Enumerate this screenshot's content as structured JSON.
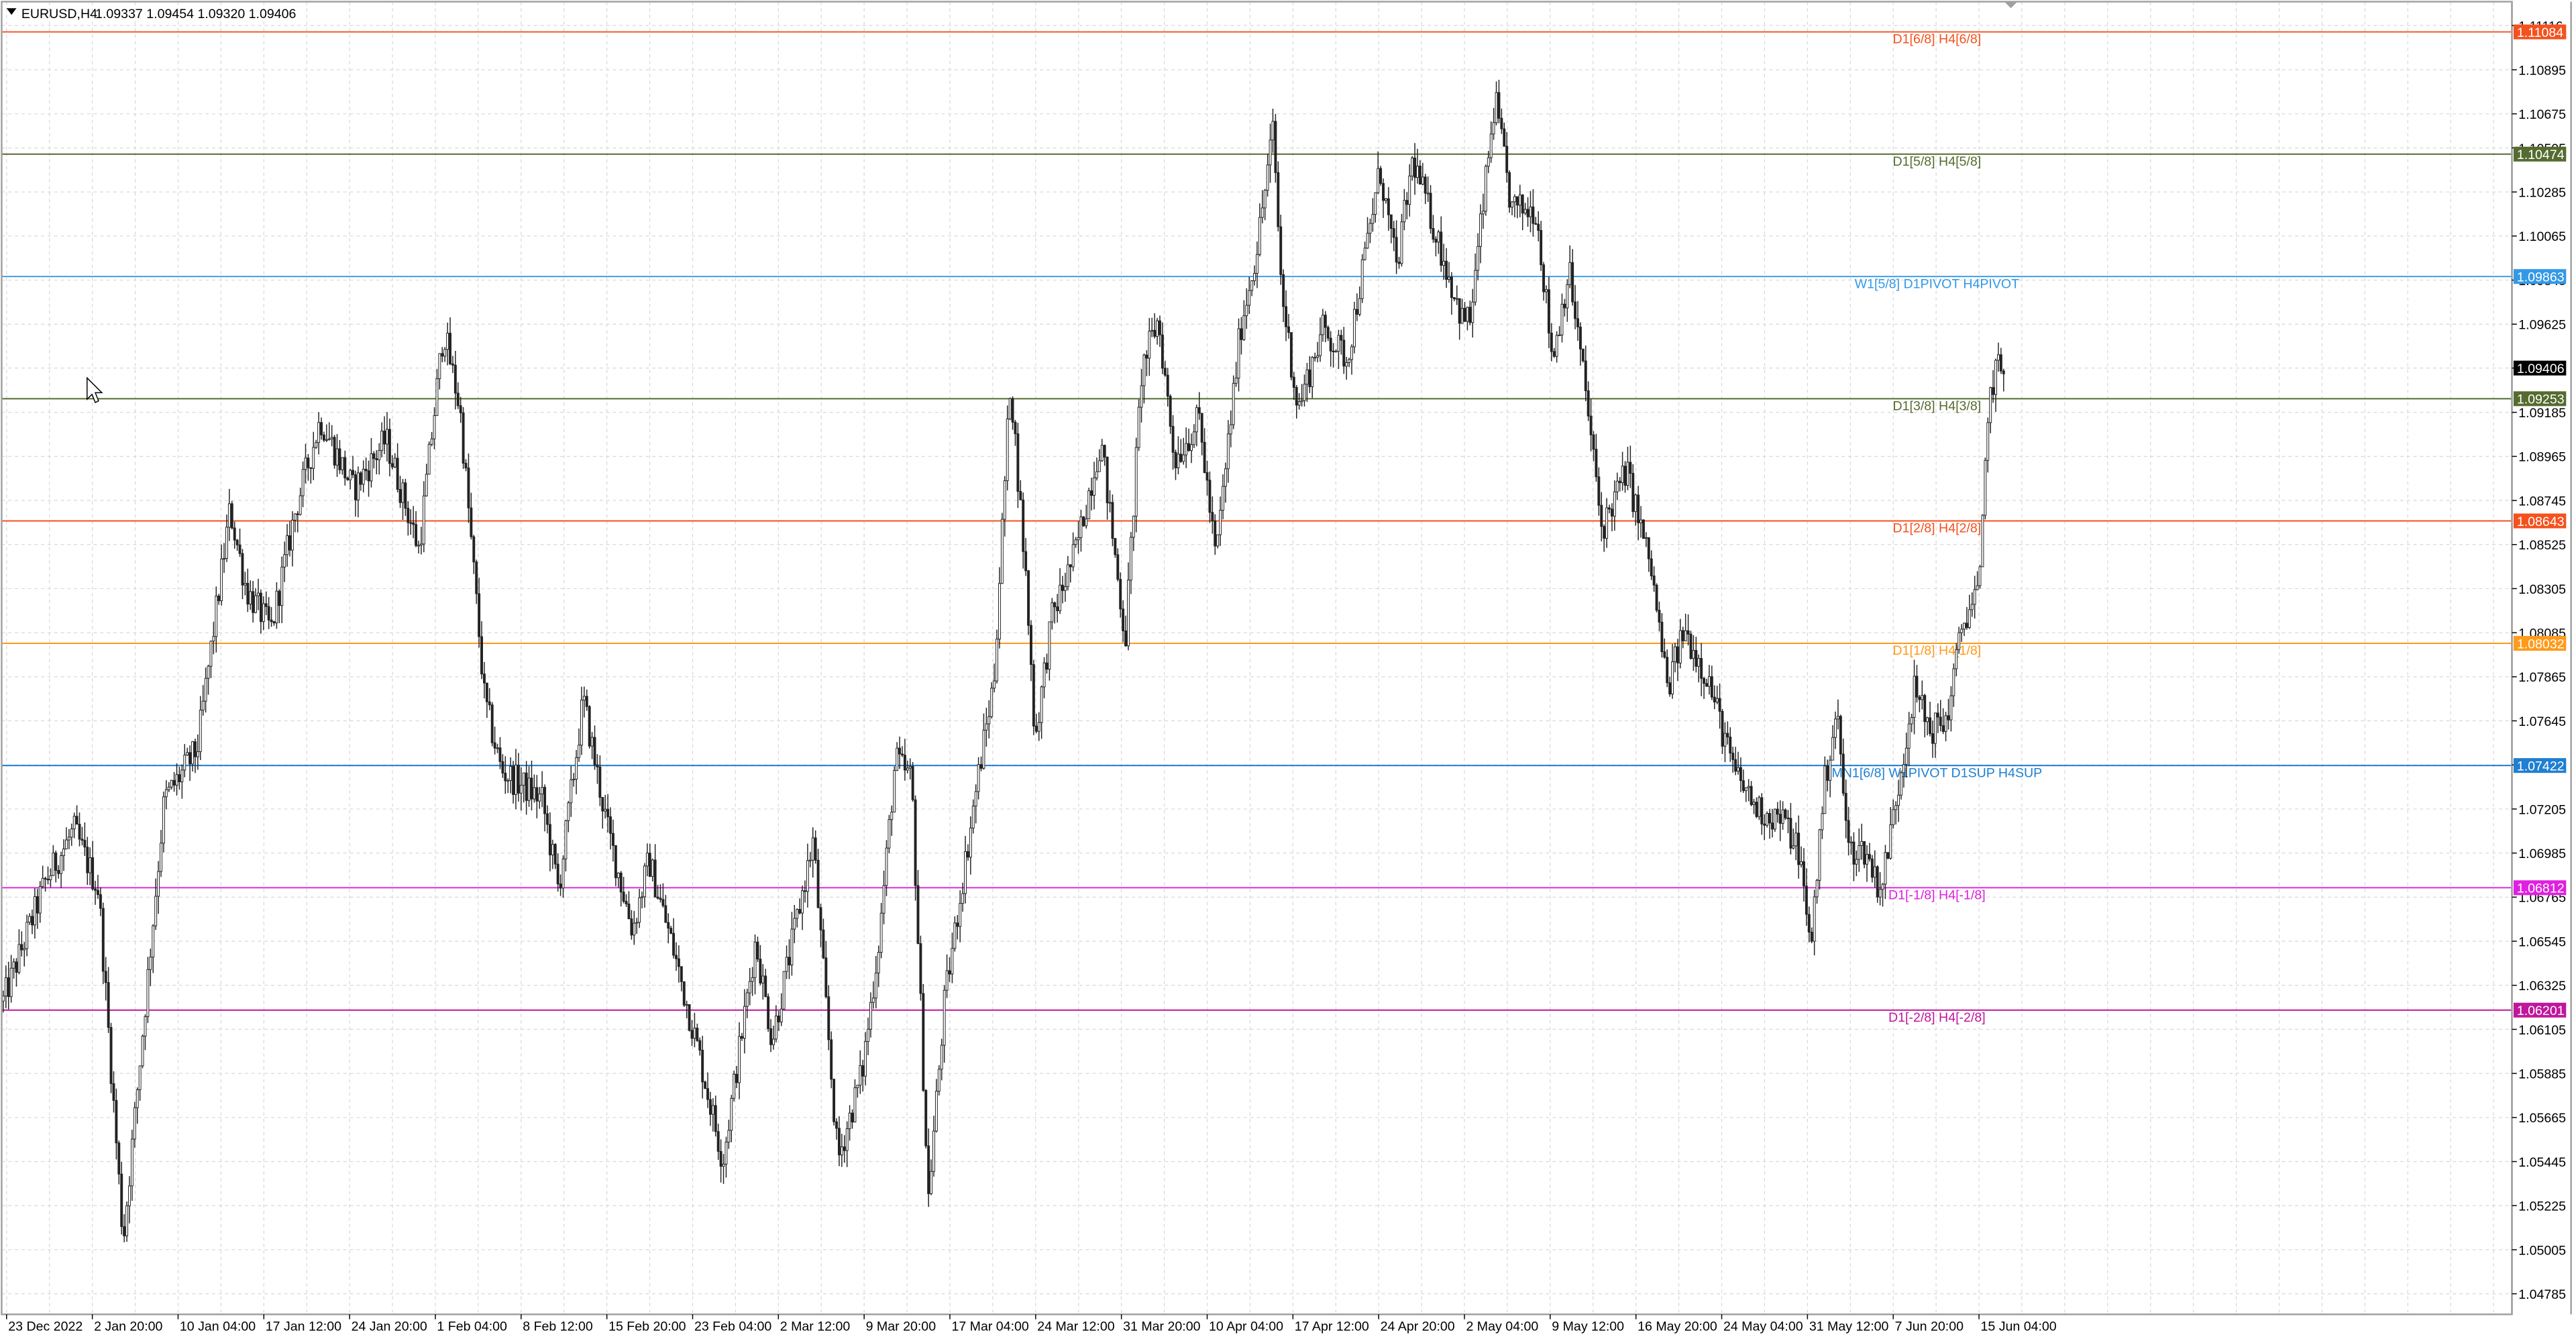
{
  "header": {
    "symbol_timeframe": "EURUSD,H4",
    "ohlc": "1.09337 1.09454 1.09320 1.09406",
    "menu_icon": "triangle-down-icon"
  },
  "chart_data": {
    "type": "candlestick",
    "symbol": "EURUSD",
    "timeframe": "H4",
    "last_bar": {
      "open": 1.09337,
      "high": 1.09454,
      "low": 1.0932,
      "close": 1.09406
    },
    "current_price": 1.09406,
    "ylim": [
      1.04675,
      1.11216
    ],
    "grid": true,
    "price_ticks": [
      "1.11116",
      "1.10895",
      "1.10675",
      "1.10505",
      "1.10285",
      "1.10065",
      "1.09845",
      "1.09625",
      "1.09406",
      "1.09185",
      "1.08965",
      "1.08745",
      "1.08525",
      "1.08305",
      "1.08085",
      "1.07865",
      "1.07645",
      "1.07425",
      "1.07205",
      "1.06985",
      "1.06765",
      "1.06545",
      "1.06325",
      "1.06105",
      "1.05885",
      "1.05665",
      "1.05445",
      "1.05225",
      "1.05005",
      "1.04785"
    ],
    "time_ticks": [
      "23 Dec 2022",
      "2 Jan 20:00",
      "10 Jan 04:00",
      "17 Jan 12:00",
      "24 Jan 20:00",
      "1 Feb 04:00",
      "8 Feb 12:00",
      "15 Feb 20:00",
      "23 Feb 04:00",
      "2 Mar 12:00",
      "9 Mar 20:00",
      "17 Mar 04:00",
      "24 Mar 12:00",
      "31 Mar 20:00",
      "10 Apr 04:00",
      "17 Apr 12:00",
      "24 Apr 20:00",
      "2 May 04:00",
      "9 May 12:00",
      "16 May 20:00",
      "24 May 04:00",
      "31 May 12:00",
      "7 Jun 20:00",
      "15 Jun 04:00"
    ],
    "levels": [
      {
        "price": 1.11084,
        "label": "D1[6/8] H4[6/8]",
        "tag": "1.11084",
        "color": "#f4511e"
      },
      {
        "price": 1.10474,
        "label": "D1[5/8] H4[5/8]",
        "tag": "1.10474",
        "color": "#556b2f"
      },
      {
        "price": 1.09863,
        "label": "W1[5/8] D1PIVOT H4PIVOT",
        "tag": "1.09863",
        "color": "#3399e6"
      },
      {
        "price": 1.09253,
        "label": "D1[3/8] H4[3/8]",
        "tag": "1.09253",
        "color": "#556b2f"
      },
      {
        "price": 1.08643,
        "label": "D1[2/8] H4[2/8]",
        "tag": "1.08643",
        "color": "#f4511e"
      },
      {
        "price": 1.08032,
        "label": "D1[1/8] H4[1/8]",
        "tag": "1.08032",
        "color": "#ff9a1a"
      },
      {
        "price": 1.07422,
        "label": "MN1[6/8] W1PIVOT D1SUP H4SUP",
        "tag": "1.07422",
        "color": "#1f7fd1"
      },
      {
        "price": 1.06812,
        "label": "D1[-1/8] H4[-1/8]",
        "tag": "1.06812",
        "color": "#e020e0"
      },
      {
        "price": 1.06201,
        "label": "D1[-2/8] H4[-2/8]",
        "tag": "1.06201",
        "color": "#c0169c"
      }
    ],
    "waypoints": [
      [
        0,
        1.062
      ],
      [
        28,
        1.0685
      ],
      [
        45,
        1.071
      ],
      [
        60,
        1.068
      ],
      [
        75,
        1.0505
      ],
      [
        100,
        1.0725
      ],
      [
        120,
        1.075
      ],
      [
        140,
        1.087
      ],
      [
        150,
        1.083
      ],
      [
        165,
        1.081
      ],
      [
        180,
        1.087
      ],
      [
        195,
        1.0915
      ],
      [
        215,
        1.088
      ],
      [
        235,
        1.0905
      ],
      [
        255,
        1.085
      ],
      [
        270,
        1.096
      ],
      [
        280,
        1.092
      ],
      [
        295,
        1.0775
      ],
      [
        305,
        1.074
      ],
      [
        330,
        1.0725
      ],
      [
        340,
        1.068
      ],
      [
        355,
        1.0775
      ],
      [
        370,
        1.071
      ],
      [
        385,
        1.066
      ],
      [
        395,
        1.0695
      ],
      [
        410,
        1.065
      ],
      [
        425,
        1.06
      ],
      [
        440,
        1.0545
      ],
      [
        460,
        1.0655
      ],
      [
        470,
        1.0605
      ],
      [
        485,
        1.0665
      ],
      [
        495,
        1.0705
      ],
      [
        510,
        1.0545
      ],
      [
        525,
        1.059
      ],
      [
        535,
        1.0655
      ],
      [
        545,
        1.0745
      ],
      [
        555,
        1.0735
      ],
      [
        565,
        1.0525
      ],
      [
        575,
        1.0625
      ],
      [
        585,
        1.068
      ],
      [
        595,
        1.0735
      ],
      [
        605,
        1.0785
      ],
      [
        615,
        1.0935
      ],
      [
        625,
        1.083
      ],
      [
        630,
        1.0755
      ],
      [
        640,
        1.0815
      ],
      [
        655,
        1.085
      ],
      [
        670,
        1.0905
      ],
      [
        685,
        1.0805
      ],
      [
        695,
        1.094
      ],
      [
        705,
        1.0965
      ],
      [
        715,
        1.0895
      ],
      [
        730,
        1.0915
      ],
      [
        740,
        1.0845
      ],
      [
        755,
        1.096
      ],
      [
        765,
        1.1
      ],
      [
        775,
        1.106
      ],
      [
        780,
        1.098
      ],
      [
        790,
        1.092
      ],
      [
        805,
        1.096
      ],
      [
        820,
        1.0945
      ],
      [
        840,
        1.104
      ],
      [
        850,
        1.099
      ],
      [
        860,
        1.1045
      ],
      [
        875,
        1.1005
      ],
      [
        890,
        1.0965
      ],
      [
        895,
        1.0965
      ],
      [
        910,
        1.1075
      ],
      [
        920,
        1.102
      ],
      [
        935,
        1.102
      ],
      [
        945,
        1.0945
      ],
      [
        955,
        1.099
      ],
      [
        965,
        1.093
      ],
      [
        975,
        1.086
      ],
      [
        990,
        1.089
      ],
      [
        1005,
        1.084
      ],
      [
        1015,
        1.078
      ],
      [
        1025,
        1.081
      ],
      [
        1040,
        1.0785
      ],
      [
        1055,
        1.074
      ],
      [
        1070,
        1.072
      ],
      [
        1085,
        1.0715
      ],
      [
        1095,
        1.07
      ],
      [
        1102,
        1.065
      ],
      [
        1110,
        1.073
      ],
      [
        1118,
        1.077
      ],
      [
        1125,
        1.07
      ],
      [
        1135,
        1.07
      ],
      [
        1145,
        1.068
      ],
      [
        1155,
        1.073
      ],
      [
        1165,
        1.078
      ],
      [
        1175,
        1.076
      ],
      [
        1185,
        1.0765
      ],
      [
        1195,
        1.0815
      ],
      [
        1205,
        1.083
      ],
      [
        1210,
        1.092
      ],
      [
        1215,
        1.094
      ],
      [
        1220,
        1.094
      ]
    ]
  }
}
